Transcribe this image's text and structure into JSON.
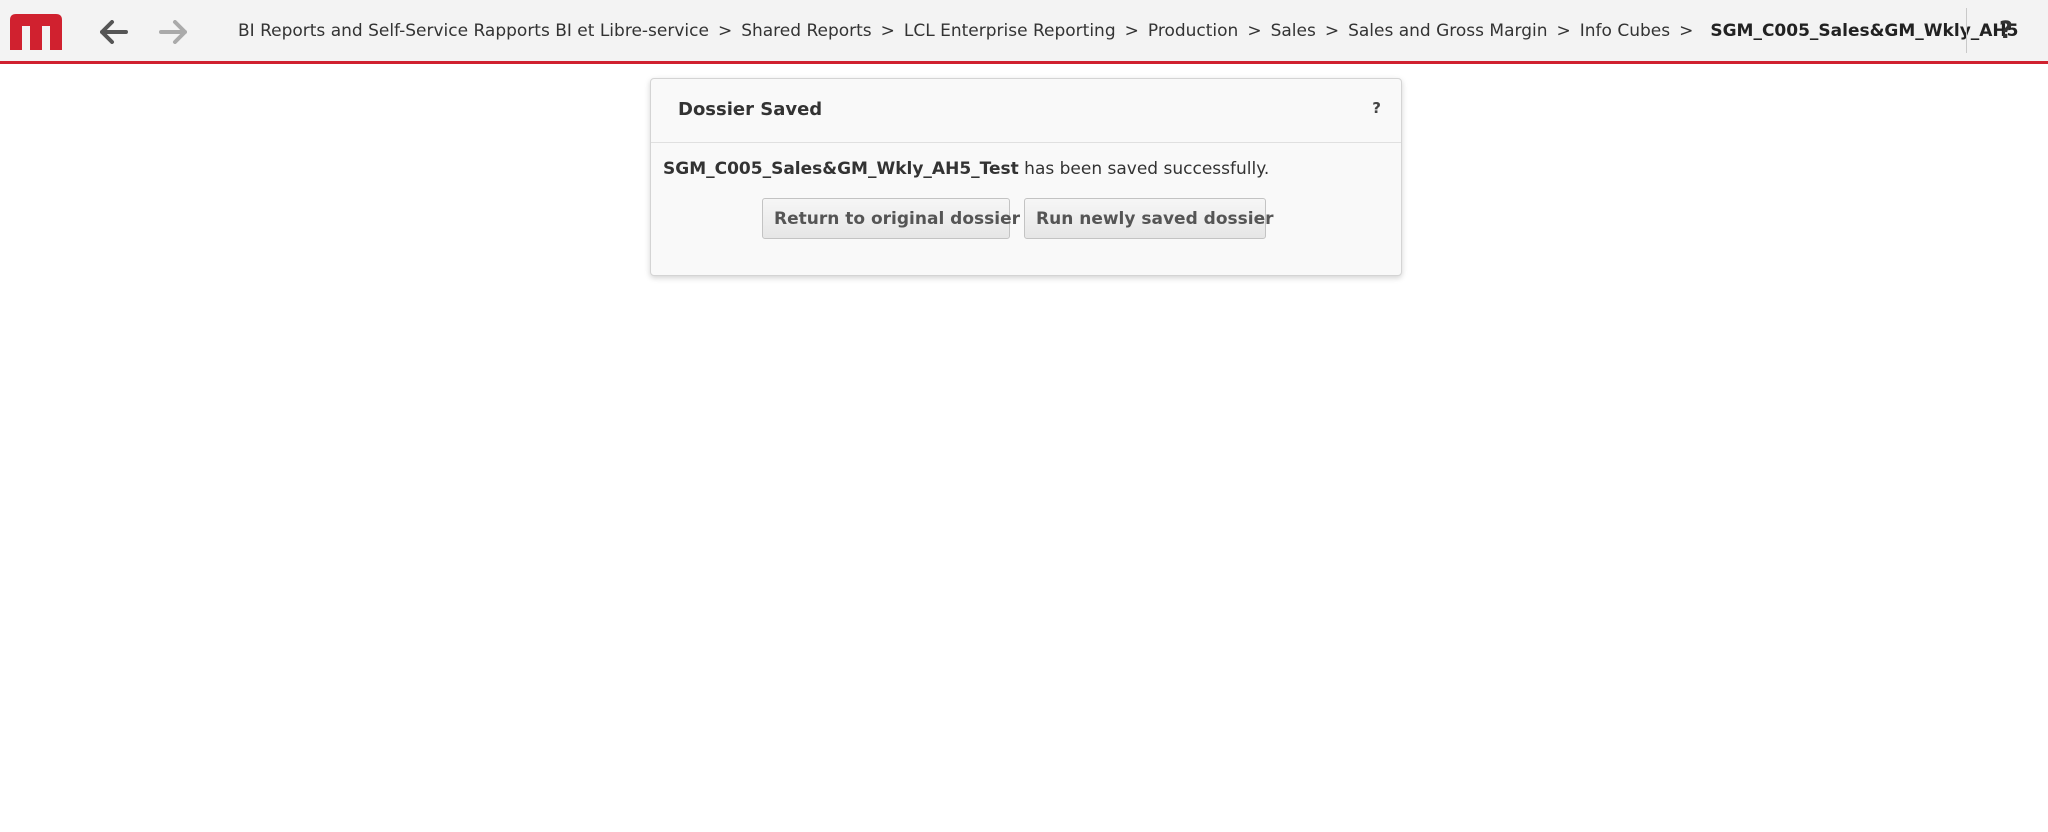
{
  "header": {
    "logo_icon": "microstrategy-logo-icon",
    "back_icon": "arrow-left-icon",
    "forward_icon": "arrow-right-icon",
    "breadcrumb": [
      "BI Reports and Self-Service Rapports BI et Libre-service",
      "Shared Reports",
      "LCL Enterprise Reporting",
      "Production",
      "Sales",
      "Sales and Gross Margin",
      "Info Cubes"
    ],
    "separator": ">",
    "current": "SGM_C005_Sales&GM_Wkly_AH5",
    "help_label": "?"
  },
  "dialog": {
    "title": "Dossier Saved",
    "help_label": "?",
    "saved_name": "SGM_C005_Sales&GM_Wkly_AH5_Test",
    "message_suffix": " has been saved successfully.",
    "return_button": "Return to original dossier",
    "run_button": "Run newly saved dossier"
  },
  "colors": {
    "accent": "#d0212f",
    "toolbar_bg": "#f3f3f3"
  }
}
